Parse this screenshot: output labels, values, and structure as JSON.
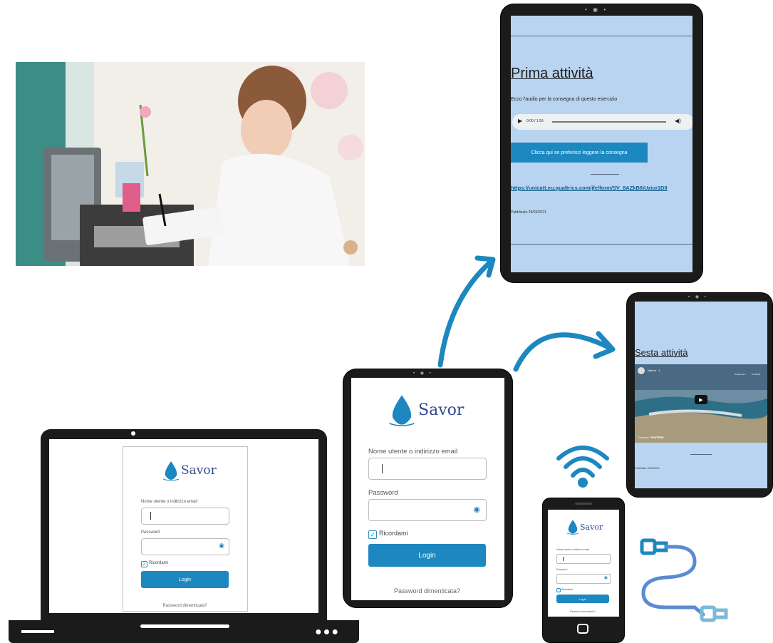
{
  "login": {
    "brand": "Savor",
    "username_label": "Nome utente o indirizzo email",
    "password_label": "Password",
    "remember_label": "Ricordami",
    "login_button": "Login",
    "forgot_link": "Password dimenticata?"
  },
  "tablet_top": {
    "title": "Prima attività",
    "subtitle": "Ecco l'audio per la consegna di questo esercizio",
    "audio_time": "0:00 / 1:59",
    "read_button": "Clicca qui se preferisci leggere la consegna",
    "link": "https://unicatt.eu.qualtrics.com/jfe/form/SV_8AZkB6iUziur1D8",
    "published": "Pubblicato 29/03/2021"
  },
  "tablet_right": {
    "title": "Sesta attività",
    "video_channel": "Natura - 1",
    "video_watch_later": "Guarda più...",
    "video_share": "Condividi",
    "video_watch_on": "Guarda su",
    "video_platform": "YouTube",
    "published": "Pubblicato 13/04/2021"
  },
  "colors": {
    "accent": "#1d87bf",
    "brand_text": "#2f4a8f",
    "arrow": "#1d87bf",
    "tablet_bg": "#b9d4f1"
  },
  "icons": [
    "water-drop-logo-icon",
    "eye-icon",
    "checkbox-icon",
    "play-icon",
    "volume-icon",
    "wifi-icon",
    "usb-cable-icon",
    "arrow-icon"
  ]
}
